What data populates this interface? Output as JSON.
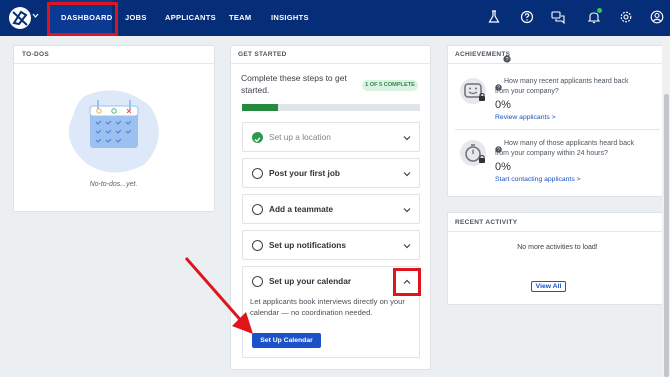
{
  "nav": {
    "items": [
      {
        "label": "DASHBOARD"
      },
      {
        "label": "JOBS"
      },
      {
        "label": "APPLICANTS"
      },
      {
        "label": "TEAM"
      },
      {
        "label": "INSIGHTS"
      }
    ],
    "icons": [
      "flask-icon",
      "help-icon",
      "chat-icon",
      "bell-icon",
      "gear-icon",
      "user-icon"
    ]
  },
  "todos": {
    "title": "TO-DOS",
    "empty": "No-to-dos...yet."
  },
  "get_started": {
    "title": "GET STARTED",
    "intro": "Complete these steps to get started.",
    "badge": "1 OF 5 COMPLETE",
    "progress": 0.2,
    "steps": [
      {
        "label": "Set up a location",
        "done": true
      },
      {
        "label": "Post your first job",
        "done": false
      },
      {
        "label": "Add a teammate",
        "done": false
      },
      {
        "label": "Set up notifications",
        "done": false
      },
      {
        "label": "Set up your calendar",
        "done": false,
        "expanded": true
      }
    ],
    "calendar_description": "Let applicants book interviews directly on your calendar — no coordination needed.",
    "calendar_button": "Set Up Calendar"
  },
  "achievements": {
    "title": "ACHIEVEMENTS",
    "items": [
      {
        "question": "How many recent applicants heard back from your company?",
        "value": "0%",
        "link": "Review applicants >"
      },
      {
        "question": "How many of those applicants heard back from your company within 24 hours?",
        "value": "0%",
        "link": "Start contacting applicants >"
      }
    ]
  },
  "recent_activity": {
    "title": "RECENT ACTIVITY",
    "empty": "No more activities to load!",
    "button": "View All"
  },
  "colors": {
    "nav": "#062d78",
    "accent": "#1b52c9",
    "success": "#2d9a4a",
    "annotation": "#e0141b"
  }
}
